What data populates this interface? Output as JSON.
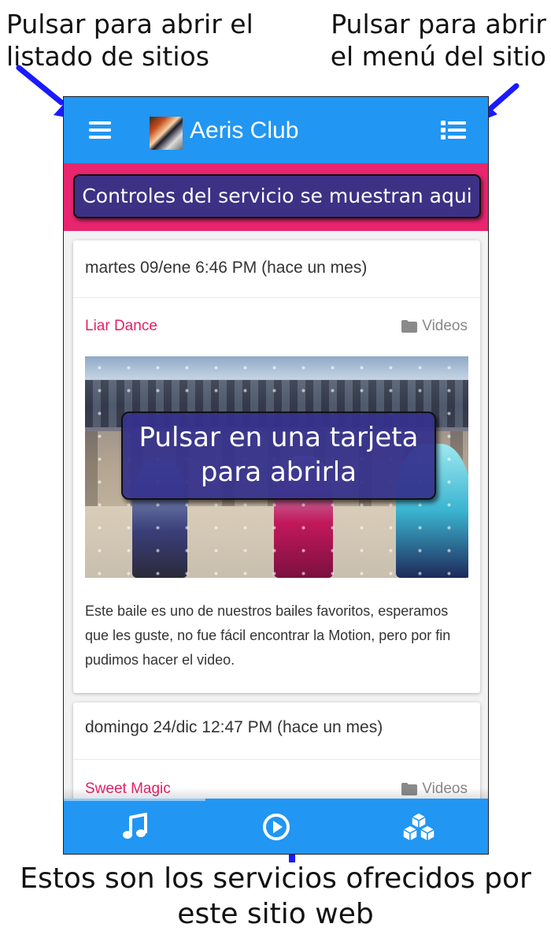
{
  "annotations": {
    "site_list": "Pulsar para abrir el listado de sitios",
    "site_menu": "Pulsar para abrir el menú del sitio",
    "services": "Estos son los servicios ofrecidos por este sitio web",
    "card_tap": "Pulsar en una tarjeta para abrirla",
    "service_controls": "Controles del servicio se muestran aqui"
  },
  "app": {
    "title": "Aeris Club",
    "accent_color": "#2196f3",
    "banner_color": "#e8256f",
    "category_color": "#e91e63"
  },
  "posts": [
    {
      "date": "martes 09/ene 6:46 PM (hace un mes)",
      "title": "Liar Dance",
      "category": "Videos",
      "description": "Este baile es uno de nuestros bailes favoritos, esperamos que les guste, no fue fácil encontrar la Motion, pero por fin pudimos hacer el video."
    },
    {
      "date": "domingo 24/dic 12:47 PM (hace un mes)",
      "title": "Sweet Magic",
      "category": "Videos"
    }
  ],
  "bottom_nav": {
    "tabs": [
      {
        "icon": "music-note-icon"
      },
      {
        "icon": "play-circle-icon"
      },
      {
        "icon": "cubes-icon"
      }
    ]
  }
}
